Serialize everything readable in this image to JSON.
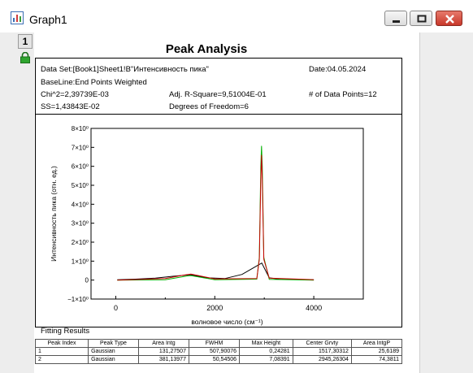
{
  "window": {
    "title": "Graph1",
    "layer_number": "1"
  },
  "report": {
    "title": "Peak Analysis",
    "dataset": "Data Set:[Book1]Sheet1!B\"Интенсивность пика\"",
    "date": "Date:04.05.2024",
    "baseline": "BaseLine:End Points Weighted",
    "chi2": "Chi^2=2,39739E-03",
    "adj_r2": "Adj. R-Square=9,51004E-01",
    "num_points": "# of Data Points=12",
    "ss": "SS=1,43843E-02",
    "dof": "Degrees of Freedom=6"
  },
  "chart_data": {
    "type": "line",
    "xlabel": "волновое число (см⁻¹)",
    "ylabel": "Интенсивность пика (отн. ед.)",
    "xlim": [
      -500,
      5000
    ],
    "ylim": [
      -1,
      8
    ],
    "x_ticks": [
      {
        "v": 0,
        "label": "0"
      },
      {
        "v": 2000,
        "label": "2000"
      },
      {
        "v": 4000,
        "label": "4000"
      }
    ],
    "y_ticks": [
      {
        "v": 8,
        "label": "8×10⁰"
      },
      {
        "v": 7,
        "label": "7×10⁰"
      },
      {
        "v": 6,
        "label": "6×10⁰"
      },
      {
        "v": 5,
        "label": "5×10⁰"
      },
      {
        "v": 4,
        "label": "4×10⁰"
      },
      {
        "v": 3,
        "label": "3×10⁰"
      },
      {
        "v": 2,
        "label": "2×10⁰"
      },
      {
        "v": 1,
        "label": "1×10⁰"
      },
      {
        "v": 0,
        "label": "0"
      },
      {
        "v": -1,
        "label": "−1×10⁰"
      }
    ],
    "series": [
      {
        "color": "#000000",
        "x": [
          30,
          400,
          800,
          1150,
          1500,
          1850,
          2200,
          2550,
          2850,
          2950,
          3100,
          3300,
          3600,
          4000
        ],
        "y": [
          0.02,
          0.05,
          0.1,
          0.2,
          0.28,
          0.12,
          0.08,
          0.3,
          0.75,
          0.9,
          0.12,
          0.05,
          0.03,
          0.02
        ]
      },
      {
        "color": "#00b000",
        "x": [
          30,
          1000,
          1450,
          1517,
          1600,
          2000,
          2850,
          2900,
          2930,
          2945,
          2960,
          2990,
          3100,
          4000
        ],
        "y": [
          0.0,
          0.02,
          0.22,
          0.24,
          0.2,
          0.02,
          0.05,
          1.2,
          6.0,
          7.08,
          6.0,
          1.2,
          0.04,
          0.0
        ]
      },
      {
        "color": "#cc0000",
        "x": [
          30,
          1000,
          1350,
          1517,
          1700,
          2000,
          2850,
          2900,
          2930,
          2945,
          2960,
          2990,
          3100,
          4000
        ],
        "y": [
          0.0,
          0.08,
          0.25,
          0.32,
          0.22,
          0.06,
          0.08,
          1.1,
          5.3,
          6.6,
          5.3,
          1.1,
          0.1,
          0.02
        ]
      }
    ]
  },
  "fitting": {
    "title": "Fitting Results",
    "columns": [
      "Peak Index",
      "Peak Type",
      "Area Intg",
      "FWHM",
      "Max Height",
      "Center Grvty",
      "Area IntgP"
    ],
    "rows": [
      [
        "1",
        "Gaussian",
        "131,27507",
        "507,90076",
        "0,24281",
        "1517,30312",
        "25,6189"
      ],
      [
        "2",
        "Gaussian",
        "381,13977",
        "50,54506",
        "7,08391",
        "2945,26304",
        "74,3811"
      ]
    ]
  }
}
